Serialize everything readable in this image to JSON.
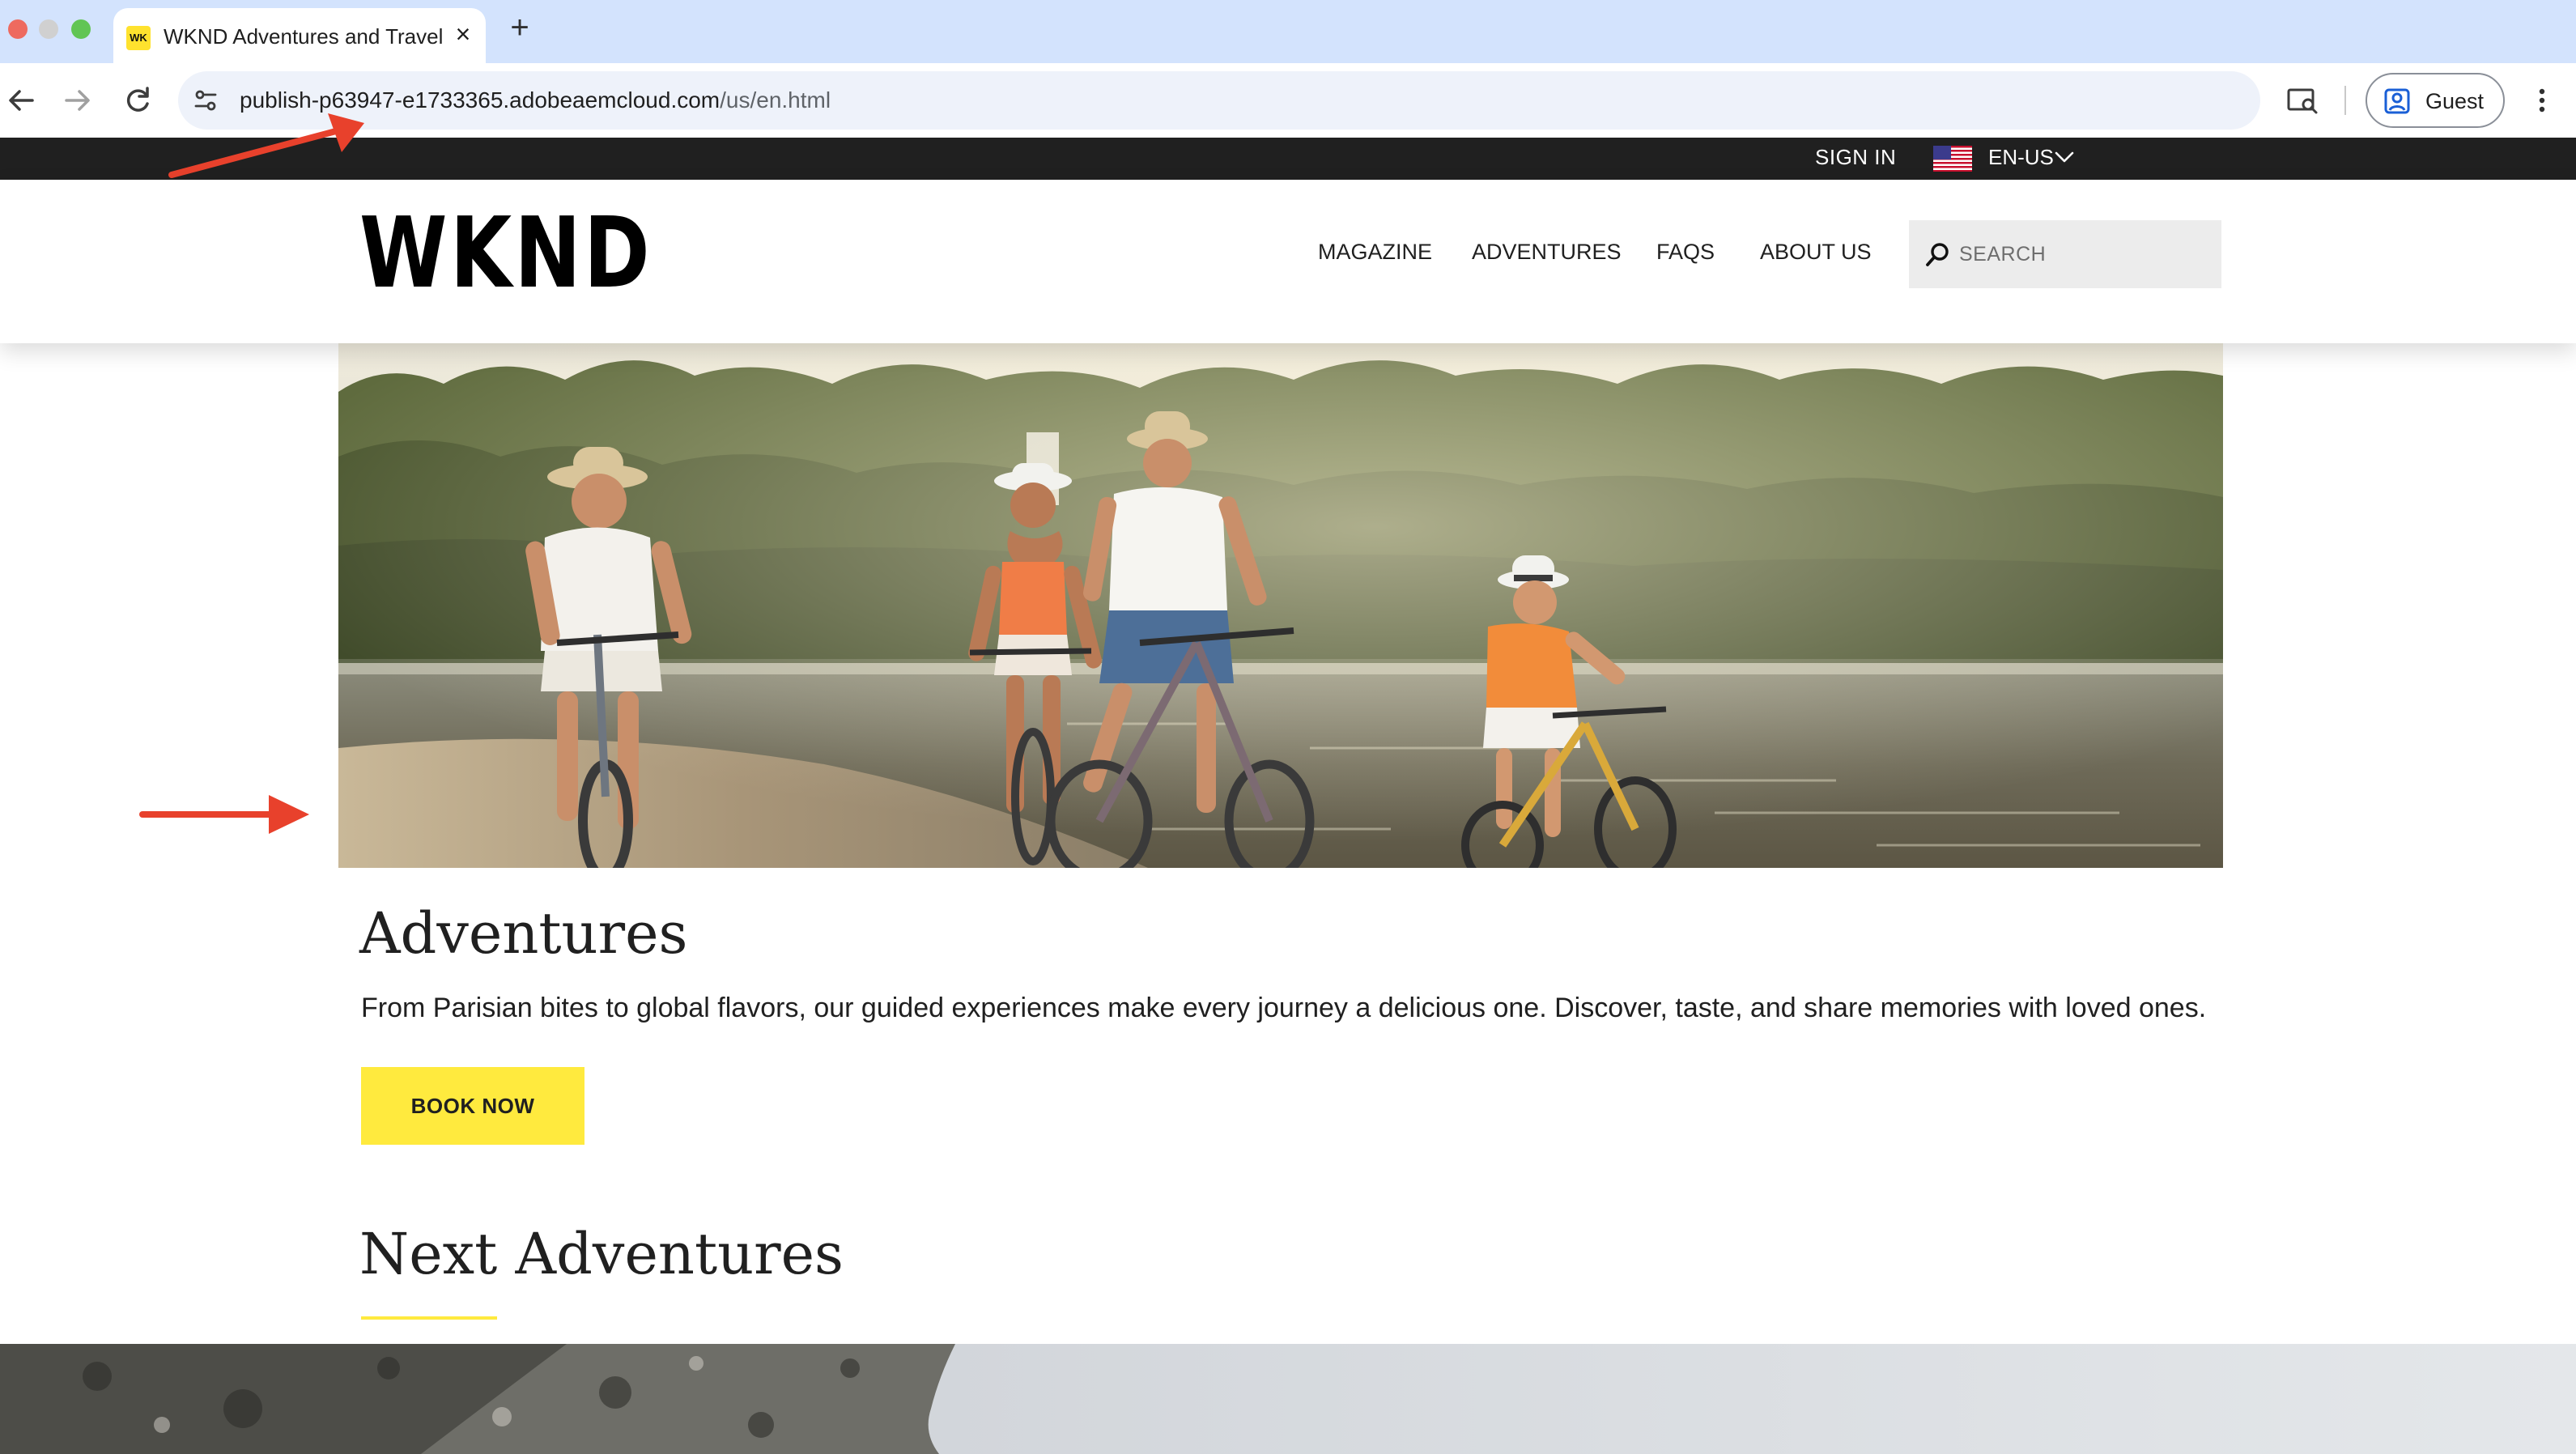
{
  "browser": {
    "tab": {
      "favicon_text": "WK",
      "title": "WKND Adventures and Travel"
    },
    "address_bar": {
      "url_host": "publish-p63947-e1733365.adobeaemcloud.com",
      "url_path": "/us/en.html"
    },
    "profile_label": "Guest"
  },
  "site": {
    "utility_bar": {
      "sign_in": "SIGN IN",
      "language": "EN-US"
    },
    "logo": "WKND",
    "nav": [
      "MAGAZINE",
      "ADVENTURES",
      "FAQS",
      "ABOUT US"
    ],
    "search": {
      "placeholder": "SEARCH"
    },
    "hero_section": {
      "title": "Adventures",
      "description": "From Parisian bites to global flavors, our guided experiences make every journey a delicious one. Discover, taste, and share memories with loved ones.",
      "cta_label": "BOOK NOW"
    },
    "next_section": {
      "title": "Next Adventures"
    }
  },
  "colors": {
    "accent_yellow": "#ffea3e",
    "utility_bar_bg": "#202020",
    "annotation_arrow": "#e8412c"
  }
}
